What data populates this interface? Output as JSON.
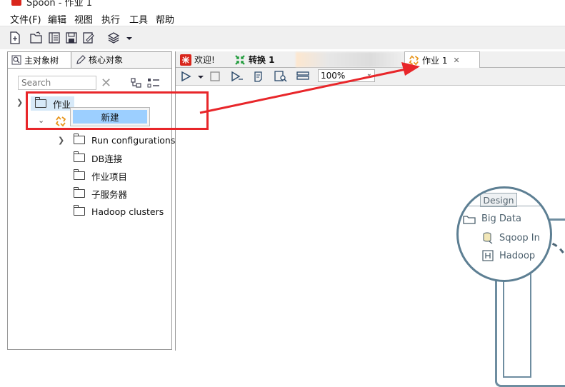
{
  "window": {
    "title": "Spoon - 作业 1"
  },
  "menu": [
    "文件(F)",
    "编辑",
    "视图",
    "执行",
    "工具",
    "帮助"
  ],
  "left_panel": {
    "tabs": [
      "主对象树",
      "核心对象"
    ],
    "search_placeholder": "Search",
    "tree": {
      "root": "作业",
      "children": [
        "Run configurations",
        "DB连接",
        "作业项目",
        "子服务器",
        "Hadoop clusters"
      ]
    },
    "context_menu": {
      "item": "新建"
    }
  },
  "editor": {
    "tabs": [
      "欢迎!",
      "转换 1",
      "作业 1"
    ],
    "zoom": "100%"
  },
  "design": {
    "tab": "Design",
    "items": [
      "Big Data",
      "Sqoop In",
      "Hadoop"
    ]
  },
  "colors": {
    "highlight_red": "#e8262a",
    "menu_selected": "#9ccfff",
    "design_accent": "#5d7f93"
  }
}
